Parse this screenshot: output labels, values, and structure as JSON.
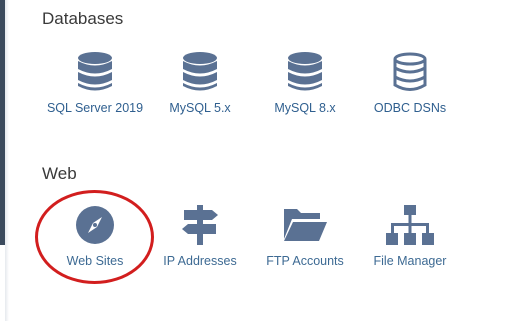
{
  "sections": {
    "databases": {
      "title": "Databases",
      "items": [
        {
          "label": "SQL Server 2019",
          "icon": "database-icon"
        },
        {
          "label": "MySQL 5.x",
          "icon": "database-icon"
        },
        {
          "label": "MySQL 8.x",
          "icon": "database-icon"
        },
        {
          "label": "ODBC DSNs",
          "icon": "database-outline-icon"
        }
      ]
    },
    "web": {
      "title": "Web",
      "items": [
        {
          "label": "Web Sites",
          "icon": "compass-icon"
        },
        {
          "label": "IP Addresses",
          "icon": "signpost-icon"
        },
        {
          "label": "FTP Accounts",
          "icon": "folder-open-icon"
        },
        {
          "label": "File Manager",
          "icon": "sitemap-icon"
        }
      ]
    }
  },
  "colors": {
    "icon": "#5a7193",
    "label": "#2f5f8f",
    "annotation": "#d21e1e"
  }
}
